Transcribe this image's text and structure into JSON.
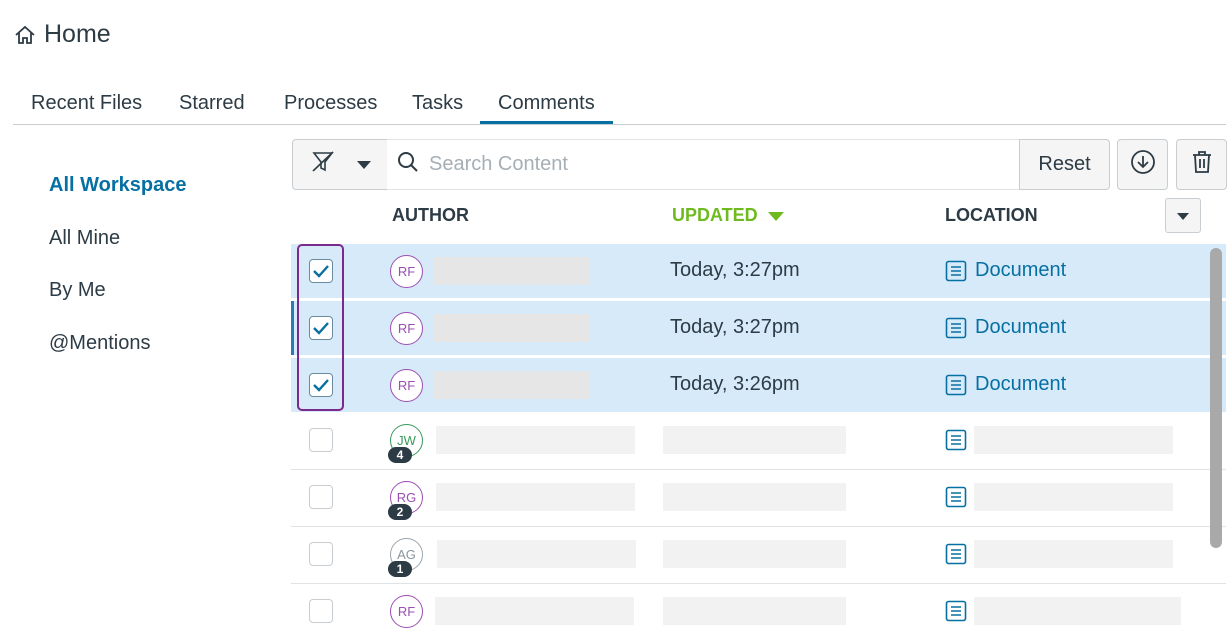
{
  "header": {
    "title": "Home",
    "icon": "home-icon"
  },
  "tabs": [
    {
      "label": "Recent Files"
    },
    {
      "label": "Starred"
    },
    {
      "label": "Processes"
    },
    {
      "label": "Tasks"
    },
    {
      "label": "Comments",
      "active": true
    }
  ],
  "sidebar": {
    "items": [
      {
        "label": "All Workspace",
        "active": true
      },
      {
        "label": "All Mine"
      },
      {
        "label": "By Me"
      },
      {
        "label": "@Mentions"
      }
    ]
  },
  "toolbar": {
    "filter_icon": "filter-off-icon",
    "search_placeholder": "Search Content",
    "reset_label": "Reset",
    "download_icon": "download-icon",
    "delete_icon": "trash-icon"
  },
  "columns": {
    "author": "AUTHOR",
    "updated": "UPDATED",
    "location": "LOCATION"
  },
  "colors": {
    "accent": "#0770a3",
    "sorted_column": "#6fba1f",
    "selected_row": "#d7eaf9",
    "highlight_box": "#7a2a8c"
  },
  "rows": [
    {
      "checked": true,
      "initials": "RF",
      "updated": "Today, 3:27pm",
      "location": "Document"
    },
    {
      "checked": true,
      "initials": "RF",
      "updated": "Today, 3:27pm",
      "location": "Document"
    },
    {
      "checked": true,
      "initials": "RF",
      "updated": "Today, 3:26pm",
      "location": "Document"
    },
    {
      "checked": false,
      "initials": "JW",
      "badge": "4"
    },
    {
      "checked": false,
      "initials": "RG",
      "badge": "2"
    },
    {
      "checked": false,
      "initials": "AG",
      "badge": "1"
    },
    {
      "checked": false,
      "initials": "RF"
    }
  ]
}
